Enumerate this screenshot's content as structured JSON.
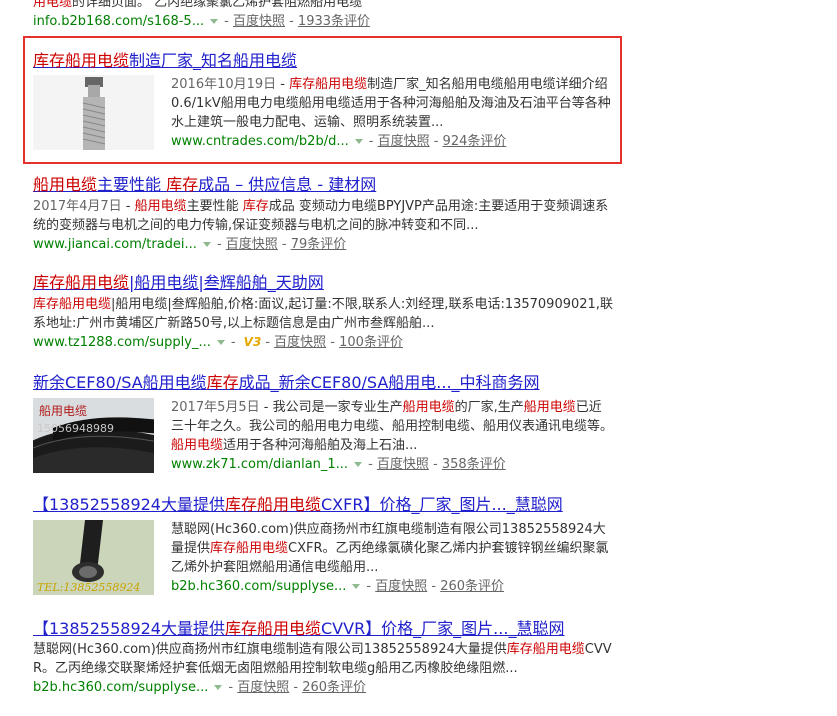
{
  "top_fragment": {
    "snippet_hl": "用电缆",
    "snippet_rest": "的详细页面。 乙丙绝缘聚氯乙烯护套阻燃船用电缆",
    "url": "info.b2b168.com/s168-5...",
    "snapshot": "百度快照",
    "reviews": "1933条评价"
  },
  "results": [
    {
      "title_parts": [
        {
          "t": "库存船用电缆",
          "hl": true
        },
        {
          "t": "制造厂家_知名船用电缆",
          "hl": false
        }
      ],
      "date": "2016年10月19日",
      "abstract_parts": [
        {
          "t": " - ",
          "hl": false
        },
        {
          "t": "库存船用电缆",
          "hl": true
        },
        {
          "t": "制造厂家_知名船用电缆船用电缆详细介绍0.6/1kV船用电力电缆船用电缆适用于各种河海船舶及海油及石油平台等各种水上建筑一般电力配电、运输、照明系统装置...",
          "hl": false
        }
      ],
      "url": "www.cntrades.com/b2b/d...",
      "snapshot": "百度快照",
      "reviews": "924条评价",
      "thumb_label": "cable-single-image"
    },
    {
      "title_parts": [
        {
          "t": "船用电缆",
          "hl": true
        },
        {
          "t": "主要性能 ",
          "hl": false
        },
        {
          "t": "库存",
          "hl": true
        },
        {
          "t": "成品 – 供应信息 - 建材网",
          "hl": false
        }
      ],
      "date": "2017年4月7日",
      "abstract_parts": [
        {
          "t": " - ",
          "hl": false
        },
        {
          "t": "船用电缆",
          "hl": true
        },
        {
          "t": "主要性能 ",
          "hl": false
        },
        {
          "t": "库存",
          "hl": true
        },
        {
          "t": "成品 变频动力电缆BPYJVP产品用途:主要适用于变频调速系统的变频器与电机之间的电力传输,保证变频器与电机之间的脉冲转变和不同...",
          "hl": false
        }
      ],
      "url": "www.jiancai.com/tradei...",
      "snapshot": "百度快照",
      "reviews": "79条评价"
    },
    {
      "title_parts": [
        {
          "t": "库存船用电缆",
          "hl": true
        },
        {
          "t": "|船用电缆|叁辉船舶_天助网",
          "hl": false
        }
      ],
      "abstract_parts": [
        {
          "t": "库存船用电缆",
          "hl": true
        },
        {
          "t": "|船用电缆|叁辉船舶,价格:面议,起订量:不限,联系人:刘经理,联系电话:13570909021,联系地址:广州市黄埔区广新路50号,以上标题信息是由广州市叁辉船舶...",
          "hl": false
        }
      ],
      "url": "www.tz1288.com/supply_...",
      "v_badge": "V3",
      "snapshot": "百度快照",
      "reviews": "100条评价"
    },
    {
      "title_parts": [
        {
          "t": "新余CEF80/SA船用电缆",
          "hl": false
        },
        {
          "t": "库存",
          "hl": true
        },
        {
          "t": "成品_新余CEF80/SA船用电..._中科商务网",
          "hl": false
        }
      ],
      "date": "2017年5月5日",
      "abstract_parts": [
        {
          "t": " - 我公司是一家专业生产",
          "hl": false
        },
        {
          "t": "船用电缆",
          "hl": true
        },
        {
          "t": "的厂家,生产",
          "hl": false
        },
        {
          "t": "船用电缆",
          "hl": true
        },
        {
          "t": "已近三十年之久。我公司的船用电力电缆、船用控制电缆、船用仪表通讯电缆等。",
          "hl": false
        },
        {
          "t": "船用电缆",
          "hl": true
        },
        {
          "t": "适用于各种河海船舶及海上石油...",
          "hl": false
        }
      ],
      "url": "www.zk71.com/dianlan_1...",
      "snapshot": "百度快照",
      "reviews": "358条评价",
      "thumb_text_1": "船用电缆",
      "thumb_text_2": "15056948989"
    },
    {
      "title_parts": [
        {
          "t": "【13852558924大量提供",
          "hl": false
        },
        {
          "t": "库存船用电缆",
          "hl": true
        },
        {
          "t": "CXFR】价格_厂家_图片..._慧聪网",
          "hl": false
        }
      ],
      "abstract_parts": [
        {
          "t": "慧聪网(Hc360.com)供应商扬州市红旗电缆制造有限公司13852558924大量提供",
          "hl": false
        },
        {
          "t": "库存船用电缆",
          "hl": true
        },
        {
          "t": "CXFR。乙丙绝缘氯磺化聚乙烯内护套镀锌钢丝编织聚氯乙烯外护套阻燃船用通信电缆船用...",
          "hl": false
        }
      ],
      "url": "b2b.hc360.com/supplyse...",
      "snapshot": "百度快照",
      "reviews": "260条评价",
      "thumb_text": "TEL:13852558924"
    },
    {
      "title_parts": [
        {
          "t": "【13852558924大量提供",
          "hl": false
        },
        {
          "t": "库存船用电缆",
          "hl": true
        },
        {
          "t": "CVVR】价格_厂家_图片..._慧聪网",
          "hl": false
        }
      ],
      "abstract_parts": [
        {
          "t": "慧聪网(Hc360.com)供应商扬州市红旗电缆制造有限公司13852558924大量提供",
          "hl": false
        },
        {
          "t": "库存船用电缆",
          "hl": true
        },
        {
          "t": "CVVR。乙丙绝缘交联聚烯烃护套低烟无卤阻燃船用控制软电缆g船用乙丙橡胶绝缘阻燃...",
          "hl": false
        }
      ],
      "url": "b2b.hc360.com/supplyse...",
      "snapshot": "百度快照",
      "reviews": "260条评价"
    }
  ],
  "colors": {
    "title_link": "#2020cc",
    "highlight": "#c00000",
    "url_green": "#008000",
    "annotation_box": "#e4312b"
  }
}
